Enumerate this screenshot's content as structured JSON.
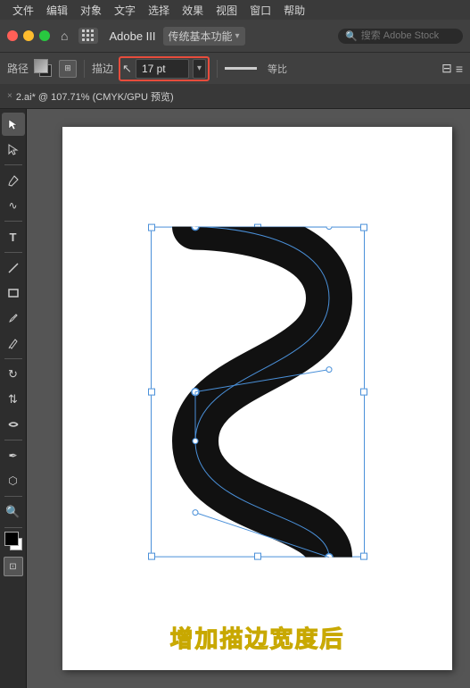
{
  "menu": {
    "items": [
      "文件",
      "编辑",
      "对象",
      "文字",
      "选择",
      "效果",
      "视图",
      "窗口",
      "帮助"
    ]
  },
  "titlebar": {
    "adobe_label": "Adobe III",
    "workspace_name": "传统基本功能",
    "search_placeholder": "搜索 Adobe Stock"
  },
  "toolbar": {
    "path_label": "路径",
    "stroke_label": "描边",
    "stroke_value": "17 pt",
    "equal_ratio": "等比",
    "align_icon": "≡"
  },
  "tab": {
    "close": "×",
    "title": "2.ai* @ 107.71% (CMYK/GPU 预览)"
  },
  "caption": {
    "text": "增加描边宽度后"
  },
  "colors": {
    "highlight_border": "#e74c3c",
    "selection_blue": "#4a90d9",
    "caption_yellow": "#f5e642"
  }
}
